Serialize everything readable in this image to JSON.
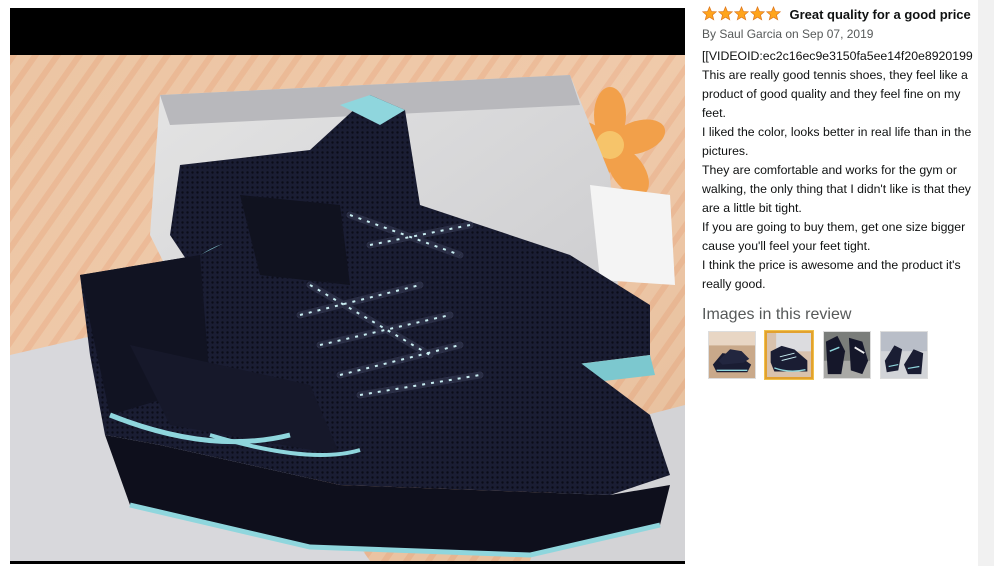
{
  "review": {
    "rating": 5,
    "title": "Great quality for a good price",
    "byline": "By Saul Garcia on Sep 07, 2019",
    "video_id_line": "[[VIDEOID:ec2c16ec9e3150fa5ee14f20e8920199",
    "paragraphs": [
      "This are really good tennis shoes, they feel like a product of good quality and they feel fine on my feet.",
      "I liked the color, looks better in real life than in the pictures.",
      "They are comfortable and works for the gym or walking, the only thing that I didn't like is that they are a little bit tight.",
      "If you are going to buy them, get one size bigger cause you'll feel your feet tight.",
      "I think the price is awesome and the product it's really good."
    ],
    "images_heading": "Images in this review",
    "thumbnails": [
      {
        "icon": "shoe-photo-thumbnail-1",
        "selected": false
      },
      {
        "icon": "shoe-photo-thumbnail-2",
        "selected": true
      },
      {
        "icon": "shoe-photo-thumbnail-3",
        "selected": false
      },
      {
        "icon": "shoe-photo-thumbnail-4",
        "selected": false
      }
    ]
  },
  "viewer": {
    "photo_icon": "navy-knit-sneakers-photo"
  },
  "colors": {
    "star": "#ffa41c",
    "star_outline": "#de7921",
    "selected_thumb_border": "#e2a12f",
    "byline": "#565959"
  }
}
